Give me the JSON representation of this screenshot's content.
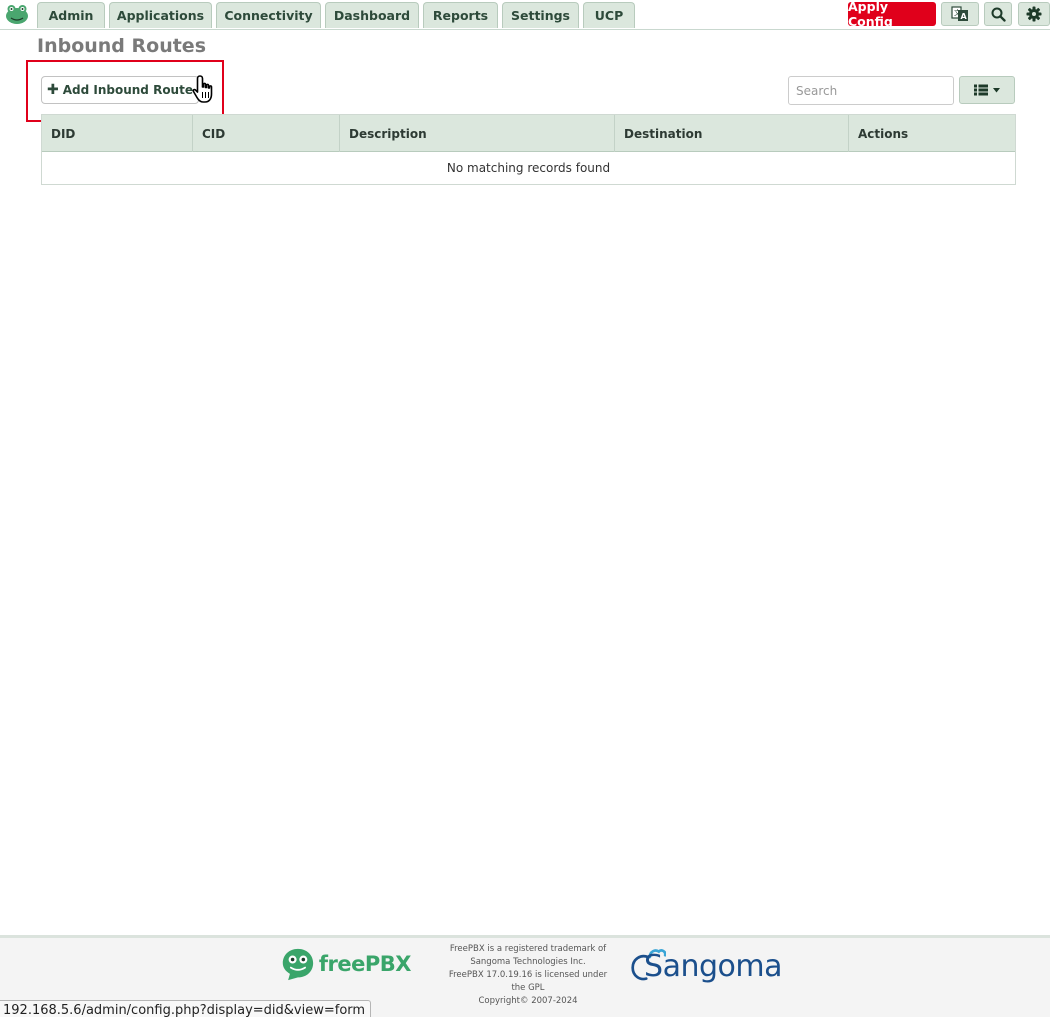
{
  "nav": {
    "tabs": [
      "Admin",
      "Applications",
      "Connectivity",
      "Dashboard",
      "Reports",
      "Settings",
      "UCP"
    ],
    "apply_config": "Apply Config"
  },
  "page": {
    "title": "Inbound Routes",
    "add_button": "Add Inbound Route"
  },
  "toolbar": {
    "search_placeholder": "Search",
    "columns_icon": "list-icon"
  },
  "table": {
    "columns": [
      "DID",
      "CID",
      "Description",
      "Destination",
      "Actions"
    ],
    "empty_message": "No matching records found"
  },
  "footer": {
    "freepbx_brand": "freePBX",
    "legal_lines": [
      "FreePBX is a registered trademark of",
      "Sangoma Technologies Inc.",
      "FreePBX 17.0.19.16 is licensed under",
      "the GPL",
      "Copyright© 2007-2024"
    ],
    "sangoma_brand": "Sangoma"
  },
  "status_bar": {
    "url": "192.168.5.6/admin/config.php?display=did&view=form"
  },
  "colors": {
    "accent_green": "#dbe7dd",
    "apply_red": "#e0001b",
    "highlight_red": "#e0001b",
    "freepbx_green": "#3aa56a",
    "sangoma_blue": "#1b4f8c"
  }
}
